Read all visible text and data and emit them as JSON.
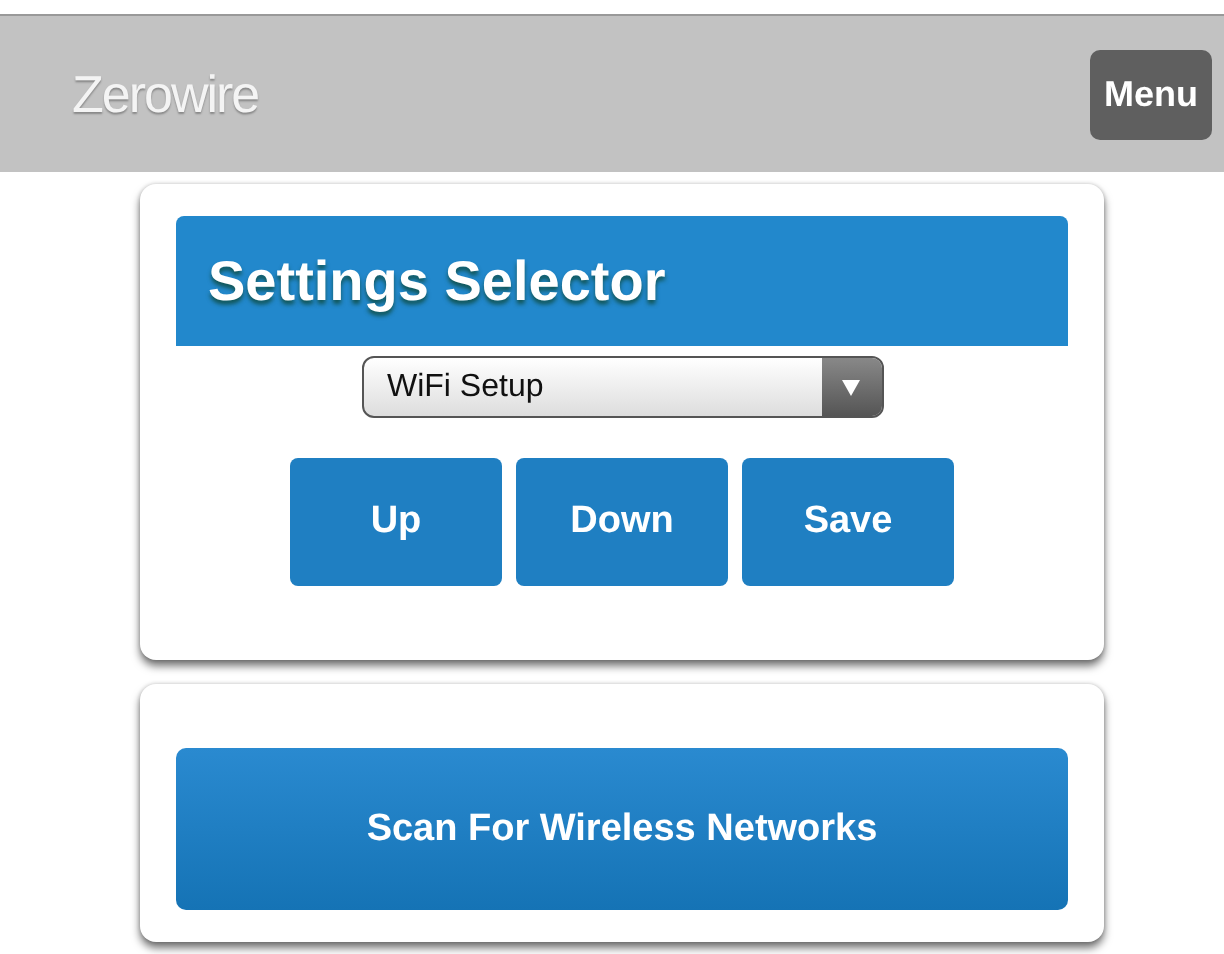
{
  "header": {
    "title": "Zerowire",
    "menu_button": "Menu"
  },
  "settings_card": {
    "title": "Settings Selector",
    "select": {
      "value": "WiFi Setup"
    },
    "buttons": [
      "Up",
      "Down",
      "Save"
    ]
  },
  "scan_card": {
    "button": "Scan For Wireless Networks"
  }
}
